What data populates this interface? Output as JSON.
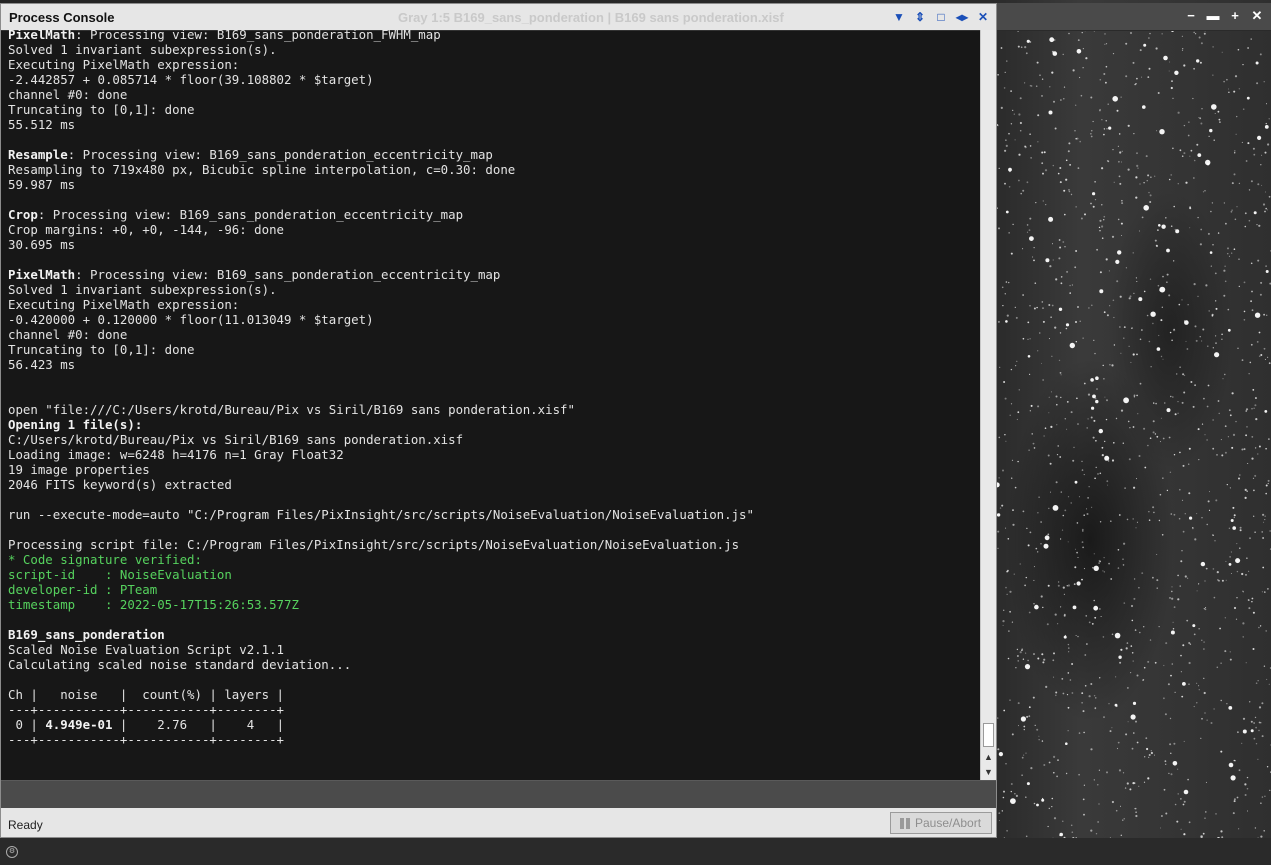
{
  "console": {
    "title": "Process Console",
    "window_title": "Gray 1:5 B169_sans_ponderation | B169 sans ponderation.xisf",
    "status": "Ready",
    "pause_label": "Pause/Abort",
    "lines": [
      {
        "parts": [
          {
            "t": "PixelMath",
            "s": "b"
          },
          {
            "t": ": Processing view: B169_sans_ponderation_FWHM_map"
          }
        ]
      },
      {
        "parts": [
          {
            "t": "Solved 1 invariant subexpression(s)."
          }
        ]
      },
      {
        "parts": [
          {
            "t": "Executing PixelMath expression:"
          }
        ]
      },
      {
        "parts": [
          {
            "t": "-2.442857 + 0.085714 * floor(39.108802 * $target)"
          }
        ]
      },
      {
        "parts": [
          {
            "t": "channel #0: done"
          }
        ]
      },
      {
        "parts": [
          {
            "t": "Truncating to [0,1]: done"
          }
        ]
      },
      {
        "parts": [
          {
            "t": "55.512 ms"
          }
        ]
      },
      {
        "parts": [
          {
            "t": ""
          }
        ]
      },
      {
        "parts": [
          {
            "t": "Resample",
            "s": "b"
          },
          {
            "t": ": Processing view: B169_sans_ponderation_eccentricity_map"
          }
        ]
      },
      {
        "parts": [
          {
            "t": "Resampling to 719x480 px, Bicubic spline interpolation, c=0.30: done"
          }
        ]
      },
      {
        "parts": [
          {
            "t": "59.987 ms"
          }
        ]
      },
      {
        "parts": [
          {
            "t": ""
          }
        ]
      },
      {
        "parts": [
          {
            "t": "Crop",
            "s": "b"
          },
          {
            "t": ": Processing view: B169_sans_ponderation_eccentricity_map"
          }
        ]
      },
      {
        "parts": [
          {
            "t": "Crop margins: +0, +0, -144, -96: done"
          }
        ]
      },
      {
        "parts": [
          {
            "t": "30.695 ms"
          }
        ]
      },
      {
        "parts": [
          {
            "t": ""
          }
        ]
      },
      {
        "parts": [
          {
            "t": "PixelMath",
            "s": "b"
          },
          {
            "t": ": Processing view: B169_sans_ponderation_eccentricity_map"
          }
        ]
      },
      {
        "parts": [
          {
            "t": "Solved 1 invariant subexpression(s)."
          }
        ]
      },
      {
        "parts": [
          {
            "t": "Executing PixelMath expression:"
          }
        ]
      },
      {
        "parts": [
          {
            "t": "-0.420000 + 0.120000 * floor(11.013049 * $target)"
          }
        ]
      },
      {
        "parts": [
          {
            "t": "channel #0: done"
          }
        ]
      },
      {
        "parts": [
          {
            "t": "Truncating to [0,1]: done"
          }
        ]
      },
      {
        "parts": [
          {
            "t": "56.423 ms"
          }
        ]
      },
      {
        "parts": [
          {
            "t": ""
          }
        ]
      },
      {
        "parts": [
          {
            "t": ""
          }
        ]
      },
      {
        "parts": [
          {
            "t": "open \"file:///C:/Users/krotd/Bureau/Pix vs Siril/B169 sans ponderation.xisf\""
          }
        ]
      },
      {
        "parts": [
          {
            "t": "Opening 1 file(s):",
            "s": "b"
          }
        ]
      },
      {
        "parts": [
          {
            "t": "C:/Users/krotd/Bureau/Pix vs Siril/B169 sans ponderation.xisf"
          }
        ]
      },
      {
        "parts": [
          {
            "t": "Loading image: w=6248 h=4176 n=1 Gray Float32"
          }
        ]
      },
      {
        "parts": [
          {
            "t": "19 image properties"
          }
        ]
      },
      {
        "parts": [
          {
            "t": "2046 FITS keyword(s) extracted"
          }
        ]
      },
      {
        "parts": [
          {
            "t": ""
          }
        ]
      },
      {
        "parts": [
          {
            "t": "run --execute-mode=auto \"C:/Program Files/PixInsight/src/scripts/NoiseEvaluation/NoiseEvaluation.js\""
          }
        ]
      },
      {
        "parts": [
          {
            "t": ""
          }
        ]
      },
      {
        "parts": [
          {
            "t": "Processing script file: C:/Program Files/PixInsight/src/scripts/NoiseEvaluation/NoiseEvaluation.js"
          }
        ]
      },
      {
        "parts": [
          {
            "t": "* Code signature verified:",
            "s": "g"
          }
        ]
      },
      {
        "parts": [
          {
            "t": "script-id    : NoiseEvaluation",
            "s": "g"
          }
        ]
      },
      {
        "parts": [
          {
            "t": "developer-id : PTeam",
            "s": "g"
          }
        ]
      },
      {
        "parts": [
          {
            "t": "timestamp    : 2022-05-17T15:26:53.577Z",
            "s": "g"
          }
        ]
      },
      {
        "parts": [
          {
            "t": ""
          }
        ]
      },
      {
        "parts": [
          {
            "t": "B169_sans_ponderation",
            "s": "b"
          }
        ]
      },
      {
        "parts": [
          {
            "t": "Scaled Noise Evaluation Script v2.1.1"
          }
        ]
      },
      {
        "parts": [
          {
            "t": "Calculating scaled noise standard deviation..."
          }
        ]
      },
      {
        "parts": [
          {
            "t": ""
          }
        ]
      },
      {
        "parts": [
          {
            "t": "Ch |   noise   |  count(%) | layers |"
          }
        ]
      },
      {
        "parts": [
          {
            "t": "---+-----------+-----------+--------+"
          }
        ]
      },
      {
        "parts": [
          {
            "t": " 0 | "
          },
          {
            "t": "4.949e-01",
            "s": "b"
          },
          {
            "t": " |    2.76   |    4   |"
          }
        ]
      },
      {
        "parts": [
          {
            "t": "---+-----------+-----------+--------+"
          }
        ]
      }
    ]
  },
  "window_controls": {
    "console": [
      "chevron-down",
      "up-down-arrows",
      "restore",
      "shade",
      "close"
    ],
    "console_glyphs": [
      "▼",
      "⇕",
      "□",
      "◂▸",
      "✕"
    ],
    "image": [
      "minimize",
      "shade",
      "maximize",
      "close"
    ],
    "image_glyphs": [
      "−",
      "▬",
      "+",
      "✕"
    ]
  },
  "colors": {
    "console_text": "#e3e3e3",
    "signature_green": "#56d25e",
    "control_blue": "#1a4fb8"
  }
}
